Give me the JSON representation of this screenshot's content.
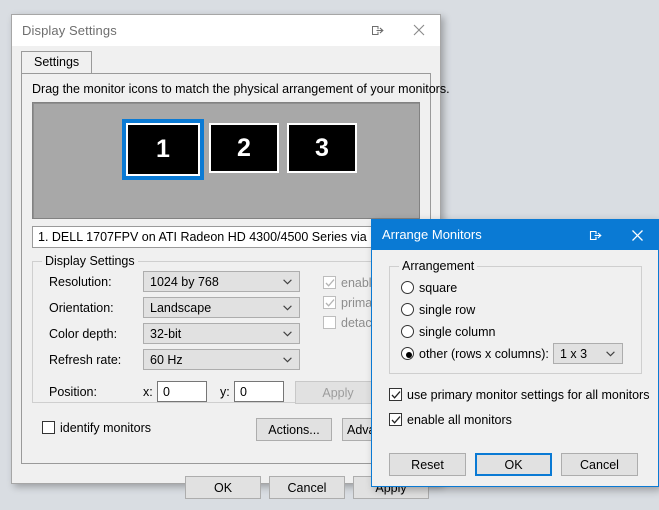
{
  "main_window": {
    "title": "Display Settings",
    "titlebar_buttons": [
      {
        "name": "restore-down-icon",
        "label": "Restore Down"
      },
      {
        "name": "close-icon",
        "label": "Close"
      }
    ],
    "tab": {
      "label": "Settings"
    },
    "hint": "Drag the monitor icons to match the physical arrangement of your monitors.",
    "monitors": [
      {
        "label": "1",
        "selected": true
      },
      {
        "label": "2",
        "selected": false
      },
      {
        "label": "3",
        "selected": false
      }
    ],
    "monitor_list": {
      "selected_item": "1. DELL 1707FPV on ATI Radeon HD 4300/4500 Series via DVI"
    },
    "display_settings": {
      "group_title": "Display Settings",
      "fields": [
        {
          "label": "Resolution:",
          "value": "1024 by 768"
        },
        {
          "label": "Orientation:",
          "value": "Landscape"
        },
        {
          "label": "Color depth:",
          "value": "32-bit"
        },
        {
          "label": "Refresh rate:",
          "value": "60 Hz"
        }
      ],
      "position": {
        "label": "Position:",
        "x_label": "x:",
        "x_value": "0",
        "y_label": "y:",
        "y_value": "0"
      },
      "apply_label": "Apply",
      "flags": [
        {
          "label": "enabled",
          "checked": true,
          "disabled": true
        },
        {
          "label": "primary",
          "checked": true,
          "disabled": true
        },
        {
          "label": "detached",
          "checked": false,
          "disabled": true
        }
      ]
    },
    "identify_monitors": {
      "label": "identify monitors",
      "checked": false
    },
    "actions_label": "Actions...",
    "advanced_label": "Advanced...",
    "footer_buttons": [
      {
        "label": "OK"
      },
      {
        "label": "Cancel"
      },
      {
        "label": "Apply"
      }
    ]
  },
  "dialog": {
    "title": "Arrange Monitors",
    "titlebar_buttons": [
      {
        "name": "restore-down-icon",
        "label": "Restore Down"
      },
      {
        "name": "close-icon",
        "label": "Close"
      }
    ],
    "arrangement": {
      "group_title": "Arrangement",
      "options": [
        {
          "label": "square",
          "selected": false
        },
        {
          "label": "single row",
          "selected": false
        },
        {
          "label": "single column",
          "selected": false
        },
        {
          "label": "other (rows x columns):",
          "selected": true
        }
      ],
      "grid_value": "1 x 3"
    },
    "checkboxes": [
      {
        "label": "use primary monitor settings for all monitors",
        "checked": true
      },
      {
        "label": "enable all monitors",
        "checked": true
      }
    ],
    "buttons": [
      {
        "label": "Reset",
        "default": false
      },
      {
        "label": "OK",
        "default": true
      },
      {
        "label": "Cancel",
        "default": false
      }
    ]
  },
  "colors": {
    "accent": "#0a7ad4",
    "window_bg": "#f0f0f0",
    "desktop_bg": "#d9dde2",
    "monitor_canvas": "#a8a8a8"
  }
}
